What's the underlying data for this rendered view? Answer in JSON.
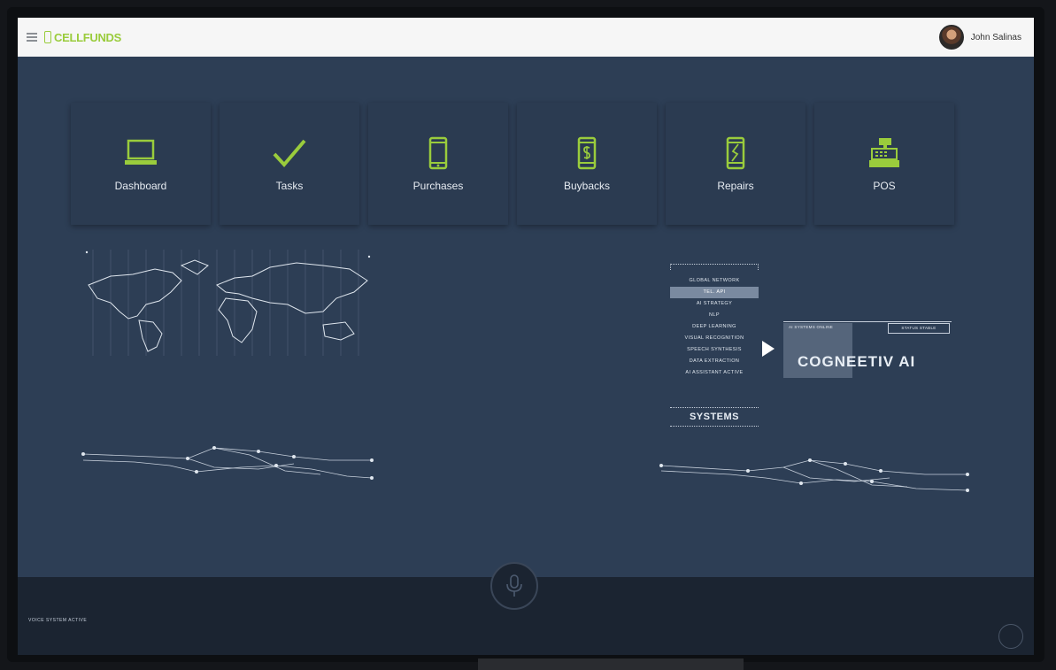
{
  "app": {
    "brand": "CELLFUNDS",
    "brand_accent": "#9acc3c",
    "screen_bg": "#2d3e55"
  },
  "header": {
    "user_name": "John Salinas"
  },
  "tiles": [
    {
      "label": "Dashboard",
      "icon": "laptop-icon"
    },
    {
      "label": "Tasks",
      "icon": "checkmark-icon"
    },
    {
      "label": "Purchases",
      "icon": "phone-icon"
    },
    {
      "label": "Buybacks",
      "icon": "phone-dollar-icon"
    },
    {
      "label": "Repairs",
      "icon": "phone-broken-icon"
    },
    {
      "label": "POS",
      "icon": "cash-register-icon"
    }
  ],
  "overlay": {
    "menu_items": [
      "GLOBAL NETWORK",
      "TEL. API",
      "AI STRATEGY",
      "NLP",
      "DEEP LEARNING",
      "VISUAL RECOGNITION",
      "SPEECH SYNTHESIS",
      "DATA EXTRACTION",
      "AI ASSISTANT ACTIVE"
    ],
    "active_index": 1,
    "systems_label": "SYSTEMS",
    "ai_title": "COGNEETIV AI",
    "ai_tagline": "AI SYSTEMS ONLINE",
    "ai_status": "STATUS STABLE"
  },
  "footer": {
    "caption": "VOICE SYSTEM ACTIVE"
  }
}
